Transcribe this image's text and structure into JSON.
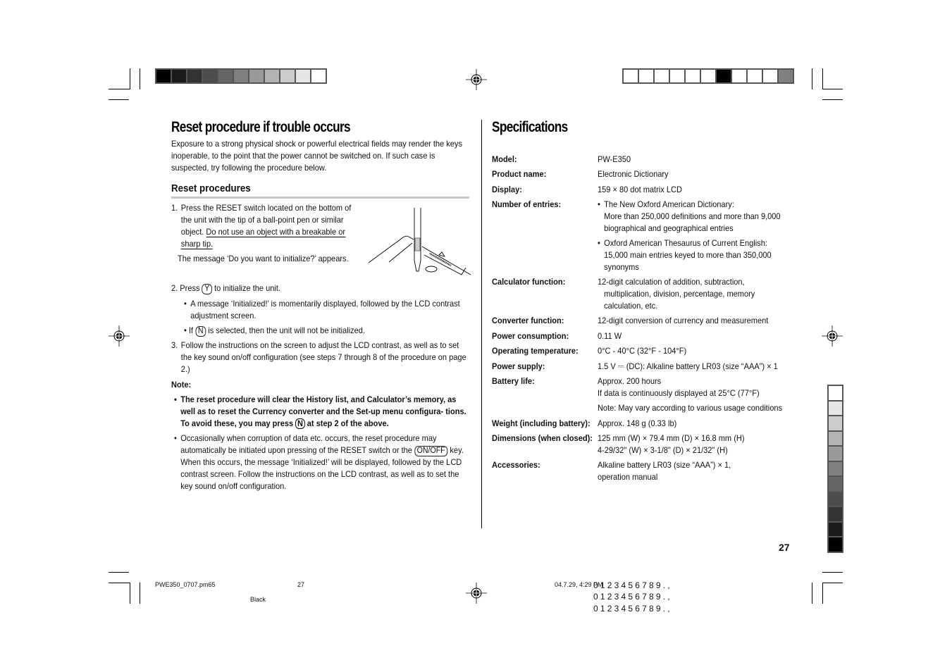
{
  "color_bars": {
    "top_left_swatches": [
      "#000000",
      "#1a1a1a",
      "#333333",
      "#4d4d4d",
      "#666666",
      "#808080",
      "#999999",
      "#b3b3b3",
      "#cccccc",
      "#e6e6e6",
      "#ffffff"
    ],
    "top_right_swatches": [
      "#ffffff",
      "#ffffff",
      "#ffffff",
      "#ffffff",
      "#ffffff",
      "#ffffff",
      "#000000",
      "#ffffff",
      "#ffffff",
      "#ffffff",
      "#808080"
    ],
    "right_side_swatches": [
      "#ffffff",
      "#e6e6e6",
      "#cccccc",
      "#b3b3b3",
      "#999999",
      "#808080",
      "#666666",
      "#4d4d4d",
      "#333333",
      "#1a1a1a",
      "#000000"
    ]
  },
  "left": {
    "title": "Reset procedure if trouble occurs",
    "intro": "Exposure to a strong physical shock or powerful electrical fields may render the keys inoperable, to the point that the power cannot be switched on. If such case is suspected, try following the procedure below.",
    "subheading": "Reset procedures",
    "step1_num": "1.",
    "step1_a": "Press the RESET switch located on the bottom of the unit with the tip of a ball-point pen or similar object.",
    "step1_warning": "Do not use an object with a breakable or sharp tip.",
    "step1_message": "The message ‘Do you want to initialize?’ appears.",
    "step2_num": "2.",
    "step2_pre": "Press",
    "step2_key": "Y",
    "step2_post": "to initialize the unit.",
    "step2_bullet1": "A message ‘Initialized!’ is momentarily displayed, followed by the LCD contrast adjustment screen.",
    "step2_bullet2_pre": "If",
    "step2_bullet2_key": "N",
    "step2_bullet2_post": "is selected, then the unit will not be initialized.",
    "step3_num": "3.",
    "step3": "Follow the instructions on the screen to adjust the LCD contrast, as well as to set the key sound on/off configuration (see steps 7 through 8 of the procedure on page 2.)",
    "note_label": "Note:",
    "note1_pre": "The reset procedure will clear the History list, and Calculator’s memory, as well as to reset the Currency converter and the Set-up menu configura- tions. To avoid these, you may press",
    "note1_key": "N",
    "note1_post": "at step 2 of the above.",
    "note2_pre": "Occasionally when corruption of data etc. occurs, the reset procedure may automatically be initiated upon pressing of the RESET switch or the",
    "note2_key": "ON/OFF",
    "note2_post": "key. When this occurs, the message ‘Initialized!’ will be displayed, followed by the LCD contrast screen. Follow the instructions on the LCD contrast, as well as to set the key sound on/off configuration.",
    "bullet": "•"
  },
  "right": {
    "title": "Specifications",
    "specs": {
      "model": {
        "label": "Model:",
        "value": "PW-E350"
      },
      "product": {
        "label": "Product name:",
        "value": "Electronic Dictionary"
      },
      "display": {
        "label": "Display:",
        "value": "159 × 80 dot matrix LCD"
      },
      "entries": {
        "label": "Number of entries:",
        "b1_title": "The New Oxford American Dictionary:",
        "b1_l2": "More than 250,000 definitions and more than 9,000",
        "b1_l3": "biographical and geographical entries",
        "b2_l1": "Oxford American Thesaurus of Current English:",
        "b2_l2": "15,000 main entries keyed to more than 350,000",
        "b2_l3": "synonyms"
      },
      "calculator": {
        "label": "Calculator function:",
        "l1": "12-digit calculation of addition, subtraction,",
        "l2": "multiplication, division, percentage, memory",
        "l3": "calculation, etc."
      },
      "converter": {
        "label": "Converter function:",
        "value": "12-digit conversion of currency and measurement"
      },
      "power_consumption": {
        "label": "Power consumption:",
        "value": "0.11 W"
      },
      "temperature": {
        "label": "Operating temperature:",
        "value": "0°C - 40°C (32°F - 104°F)"
      },
      "power_supply": {
        "label": "Power supply:",
        "pre": "1.5 V",
        "dc_symbol": "⎓",
        "post": "(DC): Alkaline battery LR03 (size “AAA”) × 1"
      },
      "battery": {
        "label": "Battery life:",
        "l1": "Approx. 200 hours",
        "l2": "If data is continuously displayed at 25°C (77°F)",
        "l3": "Note: May vary according to various usage conditions"
      },
      "weight": {
        "label": "Weight (including battery):",
        "value": "Approx. 148 g (0.33 lb)"
      },
      "dimensions": {
        "label": "Dimensions (when closed):",
        "l1": "125 mm (W) × 79.4 mm (D) × 16.8 mm (H)",
        "l2": "4-29/32\" (W) × 3-1/8\" (D) × 21/32\" (H)"
      },
      "accessories": {
        "label": "Accessories:",
        "l1": "Alkaline battery LR03 (size “AAA”) × 1,",
        "l2": "operation manual"
      }
    },
    "page_number": "27"
  },
  "footer": {
    "filename": "PWE350_0707.pm65",
    "page": "27",
    "plate": "Black",
    "timestamp": "04.7.29, 4:29 PM",
    "digits1": "0123456789.,",
    "digits2": "0123456789.,",
    "digits3": "0123456789.,"
  }
}
